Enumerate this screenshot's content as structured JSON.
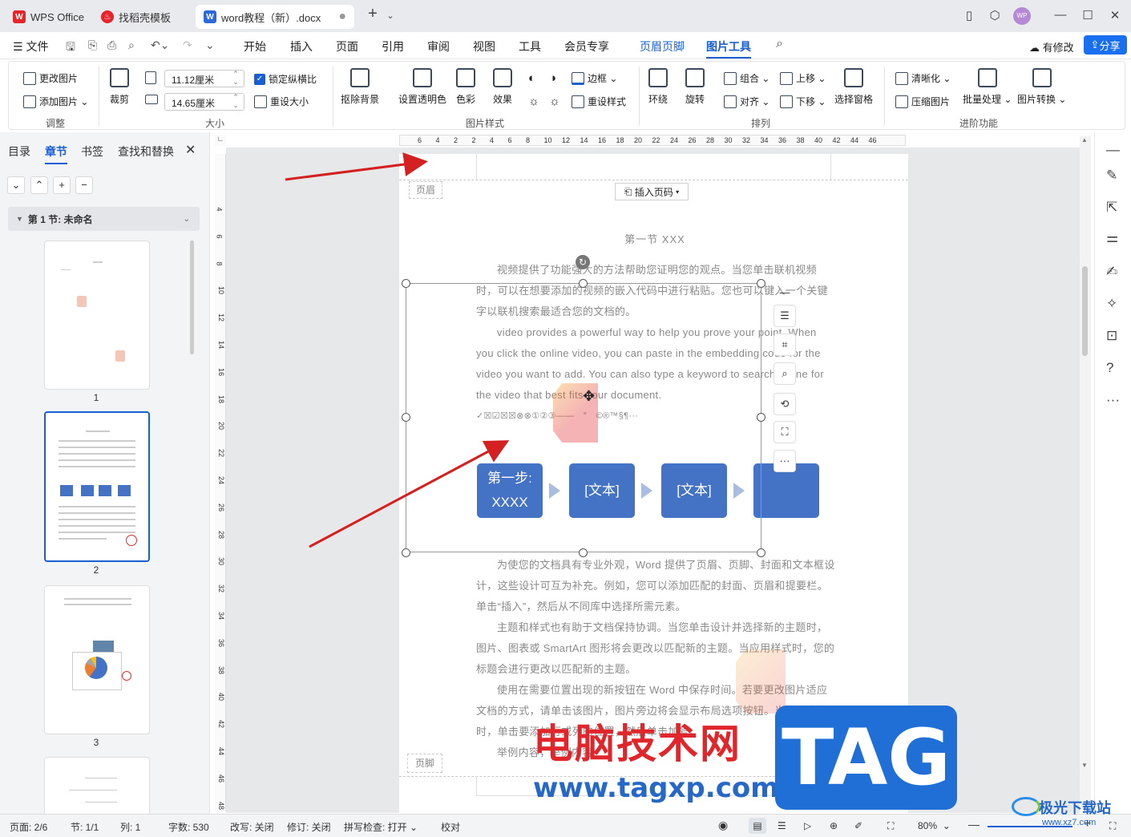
{
  "tabs": [
    {
      "label": "WPS Office"
    },
    {
      "label": "找稻壳模板"
    },
    {
      "label": "word教程（新）.docx"
    }
  ],
  "menu": {
    "file": "文件",
    "items": [
      "开始",
      "插入",
      "页面",
      "引用",
      "审阅",
      "视图",
      "工具",
      "会员专享",
      "页眉页脚",
      "图片工具"
    ],
    "modified": "有修改",
    "share": "分享"
  },
  "ribbon": {
    "change_image": "更改图片",
    "add_image": "添加图片",
    "crop": "裁剪",
    "width": "11.12厘米",
    "height": "14.65厘米",
    "lock_ratio": "锁定纵横比",
    "reset_size": "重设大小",
    "remove_bg": "抠除背景",
    "set_transparent": "设置透明色",
    "color": "色彩",
    "effect": "效果",
    "border": "边框",
    "reset_style": "重设样式",
    "wrap": "环绕",
    "rotate": "旋转",
    "group": "组合",
    "align": "对齐",
    "move_up": "上移",
    "move_down": "下移",
    "select_pane": "选择窗格",
    "sharpen": "清晰化",
    "compress": "压缩图片",
    "batch": "批量处理",
    "convert": "图片转换",
    "groups": {
      "adjust": "调整",
      "size": "大小",
      "style": "图片样式",
      "arrange": "排列",
      "advanced": "进阶功能"
    }
  },
  "left_panel": {
    "tabs": [
      "目录",
      "章节",
      "书签",
      "查找和替换"
    ],
    "section": "第 1 节: 未命名",
    "page_numbers": [
      "1",
      "2",
      "3"
    ]
  },
  "ruler": {
    "h": [
      "6",
      "4",
      "2",
      "2",
      "4",
      "6",
      "8",
      "10",
      "12",
      "14",
      "16",
      "18",
      "20",
      "22",
      "24",
      "26",
      "28",
      "30",
      "32",
      "34",
      "36",
      "38",
      "40",
      "42",
      "44",
      "46"
    ],
    "v": [
      "4",
      "6",
      "8",
      "10",
      "12",
      "14",
      "16",
      "18",
      "20",
      "22",
      "24",
      "26",
      "28",
      "30",
      "32",
      "34",
      "36",
      "38",
      "40",
      "42",
      "44",
      "46",
      "48"
    ]
  },
  "document": {
    "header_label": "页眉",
    "insert_page_number": "插入页码",
    "title": "第一节 XXX",
    "para1": "视频提供了功能强大的方法帮助您证明您的观点。当您单击联机视频时，可以在想要添加的视频的嵌入代码中进行粘贴。您也可以键入一个关键字以联机搜索最适合您的文档的。",
    "para2": "video provides a powerful way to help you prove your point. When you click the online video, you can paste in the embedding code for the video you want to add. You can also type a keyword to search online for the video that best fits your document.",
    "symbols": "✓☒☑☒☒⊗⊗①②③——　°　©®™§¶···",
    "steps": [
      "第一步:\nXXXX",
      "[文本]",
      "[文本]",
      ""
    ],
    "para3": "为使您的文档具有专业外观，Word 提供了页眉、页脚、封面和文本框设计，这些设计可互为补充。例如，您可以添加匹配的封面、页眉和提要栏。单击“插入”，然后从不同库中选择所需元素。",
    "para4": "主题和样式也有助于文档保持协调。当您单击设计并选择新的主题时，图片、图表或 SmartArt 图形将会更改以匹配新的主题。当应用样式时，您的标题会进行更改以匹配新的主题。",
    "para5": "使用在需要位置出现的新按钮在 Word 中保存时间。若要更改图片适应文档的方式，请单击该图片，图片旁边将会显示布局选项按钮。当处理表格时，单击要添加行或列的位置，然后单击加号。",
    "para6": "举例内容，举例内容",
    "footer_label": "页脚"
  },
  "status": {
    "page": "页面: 2/6",
    "section": "节: 1/1",
    "column": "列: 1",
    "words": "字数: 530",
    "revise_mode": "改写: 关闭",
    "track": "修订: 关闭",
    "spell": "拼写检查: 打开",
    "proof": "校对",
    "zoom": "80%"
  },
  "watermark": {
    "site_name": "电脑技术网",
    "url": "www.tagxp.com",
    "tag": "TAG",
    "brand": "极光下载站",
    "brand_url": "www.xz7.com"
  },
  "colors": {
    "accent": "#1a5fd1",
    "step_fill": "#4472c4",
    "arrow": "#d42020"
  }
}
